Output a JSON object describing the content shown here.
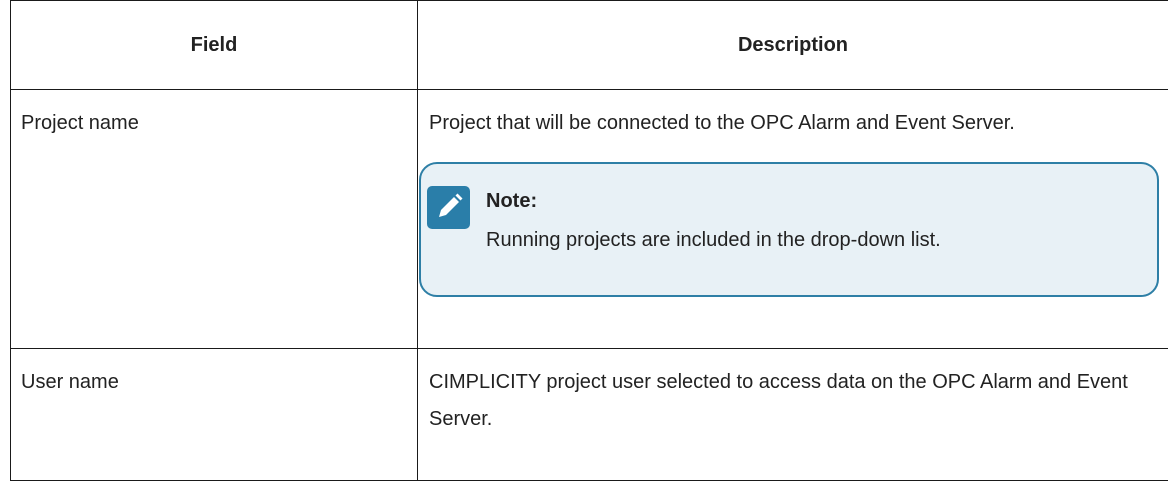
{
  "table": {
    "headers": {
      "field": "Field",
      "description": "Description"
    },
    "rows": [
      {
        "field": "Project name",
        "description": "Project that will be connected to the OPC Alarm and Event Server.",
        "note": {
          "icon": "pencil-note-icon",
          "title": "Note:",
          "text": "Running projects are included in the drop-down list."
        }
      },
      {
        "field": "User name",
        "description": "CIMPLICITY project user selected to access data on the OPC Alarm and Event Server."
      }
    ]
  },
  "colors": {
    "note_border": "#2e7fa6",
    "note_background": "#e8f1f6",
    "note_icon": "#2a7ea9",
    "table_border": "#1a1a1a"
  }
}
